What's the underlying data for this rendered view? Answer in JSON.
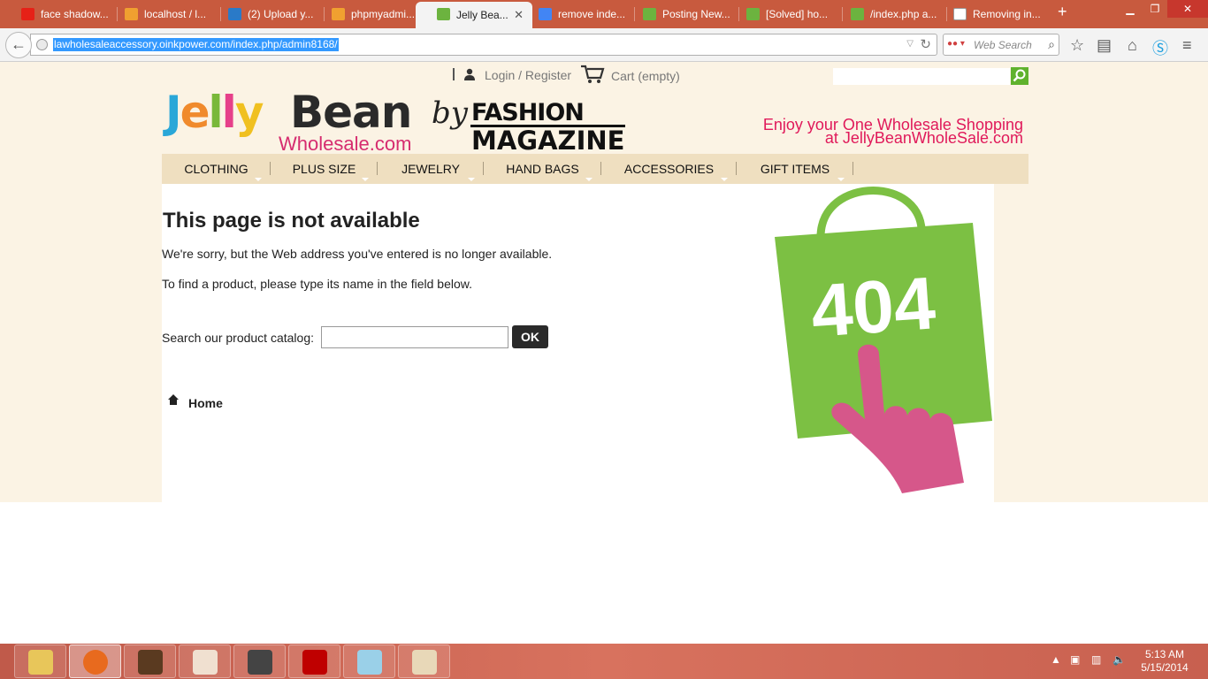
{
  "browser": {
    "tabs": [
      {
        "label": "face shadow...",
        "icon": "youtube-icon",
        "color": "#e62117"
      },
      {
        "label": "localhost / l...",
        "icon": "phpmyadmin-icon",
        "color": "#f0a030"
      },
      {
        "label": "(2) Upload y...",
        "icon": "trello-icon",
        "color": "#2a7ac8"
      },
      {
        "label": "phpmyadmi...",
        "icon": "phpmyadmin-icon",
        "color": "#f0a030"
      },
      {
        "label": "Jelly Bea...",
        "icon": "shop-icon",
        "color": "#6cb33f",
        "active": true
      },
      {
        "label": "remove inde...",
        "icon": "google-icon",
        "color": "#4285f4"
      },
      {
        "label": "Posting New...",
        "icon": "shop-icon",
        "color": "#6cb33f"
      },
      {
        "label": "[Solved] ho...",
        "icon": "shop-icon",
        "color": "#6cb33f"
      },
      {
        "label": "/index.php a...",
        "icon": "shop-icon",
        "color": "#6cb33f"
      },
      {
        "label": "Removing in...",
        "icon": "page-icon",
        "color": "#dddddd"
      }
    ],
    "url": "lawholesaleaccessory.oinkpower.com/index.php/admin8168/",
    "search_placeholder": "Web Search"
  },
  "site": {
    "login": "Login / Register",
    "cart": "Cart (empty)",
    "logo": {
      "jelly": [
        "J",
        "e",
        "l",
        "l",
        "y"
      ],
      "jelly_colors": [
        "#2aa7d8",
        "#f08a2c",
        "#79b83a",
        "#e6408a",
        "#f0c020"
      ],
      "bean": "Bean",
      "wholesale": "Wholesale.com",
      "by": "by",
      "fashion": "FASHION",
      "magazine": "MAGAZINE"
    },
    "tagline_1": "Enjoy your One Wholesale Shopping",
    "tagline_2": "at JellyBeanWholeSale.com",
    "menu": [
      "CLOTHING",
      "PLUS SIZE",
      "JEWELRY",
      "HAND BAGS",
      "ACCESSORIES",
      "GIFT ITEMS"
    ],
    "error_title": "This page is not available",
    "error_text_1": "We're sorry, but the Web address you've entered is no longer available.",
    "error_text_2": "To find a product, please type its name in the field below.",
    "catalog_label": "Search our product catalog:",
    "ok": "OK",
    "home": "Home",
    "bag_code": "404",
    "colors": {
      "bag_green": "#7cc043",
      "hand_pink": "#d6578a",
      "menu_bg": "#efdfc0",
      "page_bg": "#fbf3e4"
    }
  },
  "taskbar": {
    "time": "5:13 AM",
    "date": "5/15/2014",
    "apps": [
      "file-explorer-icon",
      "firefox-icon",
      "game-icon",
      "anime-icon",
      "sublime-icon",
      "filezilla-icon",
      "notepad-icon",
      "paint-icon"
    ]
  }
}
